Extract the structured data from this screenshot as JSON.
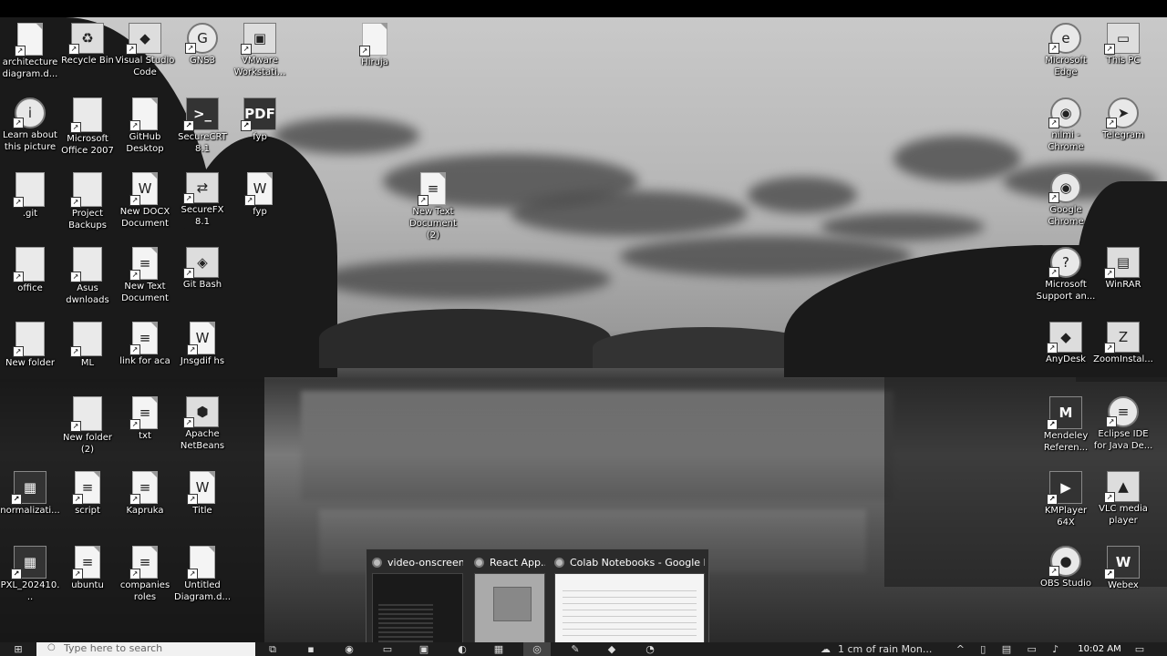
{
  "desktop_icons": [
    {
      "label": "architecture diagram.d...",
      "icon": "file-icon"
    },
    {
      "label": "Recycle Bin",
      "icon": "recycle-bin-icon"
    },
    {
      "label": "Visual Studio Code",
      "icon": "vscode-icon"
    },
    {
      "label": "GNS3",
      "icon": "gns3-icon"
    },
    {
      "label": "VMware Workstati...",
      "icon": "vmware-icon"
    },
    {
      "label": "Hiruja",
      "icon": "file-icon"
    },
    {
      "label": "Microsoft Edge",
      "icon": "edge-icon"
    },
    {
      "label": "This PC",
      "icon": "computer-icon"
    },
    {
      "label": "Learn about this picture",
      "icon": "info-icon"
    },
    {
      "label": "Microsoft Office 2007",
      "icon": "folder-icon"
    },
    {
      "label": "GitHub Desktop",
      "icon": "file-icon"
    },
    {
      "label": "SecureCRT 8.1",
      "icon": "securecrt-icon"
    },
    {
      "label": "fyp",
      "icon": "pdf-icon"
    },
    {
      "label": "nilmi - Chrome",
      "icon": "chrome-icon"
    },
    {
      "label": "Telegram",
      "icon": "telegram-icon"
    },
    {
      "label": ".git",
      "icon": "folder-icon"
    },
    {
      "label": "Project Backups",
      "icon": "folder-icon"
    },
    {
      "label": "New DOCX Document",
      "icon": "word-doc-icon"
    },
    {
      "label": "SecureFX 8.1",
      "icon": "securefx-icon"
    },
    {
      "label": "fyp",
      "icon": "word-doc-icon"
    },
    {
      "label": "New Text Document (2)",
      "icon": "text-file-icon"
    },
    {
      "label": "Google Chrome",
      "icon": "chrome-icon"
    },
    {
      "label": "office",
      "icon": "folder-icon"
    },
    {
      "label": "Asus dwnloads",
      "icon": "folder-icon"
    },
    {
      "label": "New Text Document",
      "icon": "text-file-icon"
    },
    {
      "label": "Git Bash",
      "icon": "git-bash-icon"
    },
    {
      "label": "Microsoft Support an...",
      "icon": "help-icon"
    },
    {
      "label": "WinRAR",
      "icon": "winrar-icon"
    },
    {
      "label": "New folder",
      "icon": "folder-icon"
    },
    {
      "label": "ML",
      "icon": "folder-icon"
    },
    {
      "label": "link for aca",
      "icon": "text-file-icon"
    },
    {
      "label": "Jnsgdif hs",
      "icon": "word-doc-icon"
    },
    {
      "label": "AnyDesk",
      "icon": "anydesk-icon"
    },
    {
      "label": "ZoomInstal...",
      "icon": "zoom-installer-icon"
    },
    {
      "label": "New folder (2)",
      "icon": "folder-icon"
    },
    {
      "label": "txt",
      "icon": "text-file-icon"
    },
    {
      "label": "Apache NetBeans",
      "icon": "netbeans-icon"
    },
    {
      "label": "Mendeley Referen...",
      "icon": "mendeley-icon"
    },
    {
      "label": "Eclipse IDE for Java De...",
      "icon": "eclipse-icon"
    },
    {
      "label": "normalizati...",
      "icon": "image-file-icon"
    },
    {
      "label": "script",
      "icon": "text-file-icon"
    },
    {
      "label": "Kapruka",
      "icon": "text-file-icon"
    },
    {
      "label": "Title",
      "icon": "word-doc-icon"
    },
    {
      "label": "KMPlayer 64X",
      "icon": "kmplayer-icon"
    },
    {
      "label": "VLC media player",
      "icon": "vlc-icon"
    },
    {
      "label": "PXL_202410...",
      "icon": "image-file-icon"
    },
    {
      "label": "ubuntu",
      "icon": "text-file-icon"
    },
    {
      "label": "companies roles",
      "icon": "text-file-icon"
    },
    {
      "label": "Untitled Diagram.d...",
      "icon": "file-icon"
    },
    {
      "label": "OBS Studio",
      "icon": "obs-icon"
    },
    {
      "label": "Webex",
      "icon": "webex-icon"
    }
  ],
  "taskbar_thumbnails": [
    {
      "title": "video-onscreen..."
    },
    {
      "title": "React App..."
    },
    {
      "title": "Colab Notebooks - Google Driv..."
    }
  ],
  "taskbar": {
    "search_placeholder": "Type here to search",
    "weather_text": "1 cm of rain Mon...",
    "time": "10:02 AM"
  }
}
